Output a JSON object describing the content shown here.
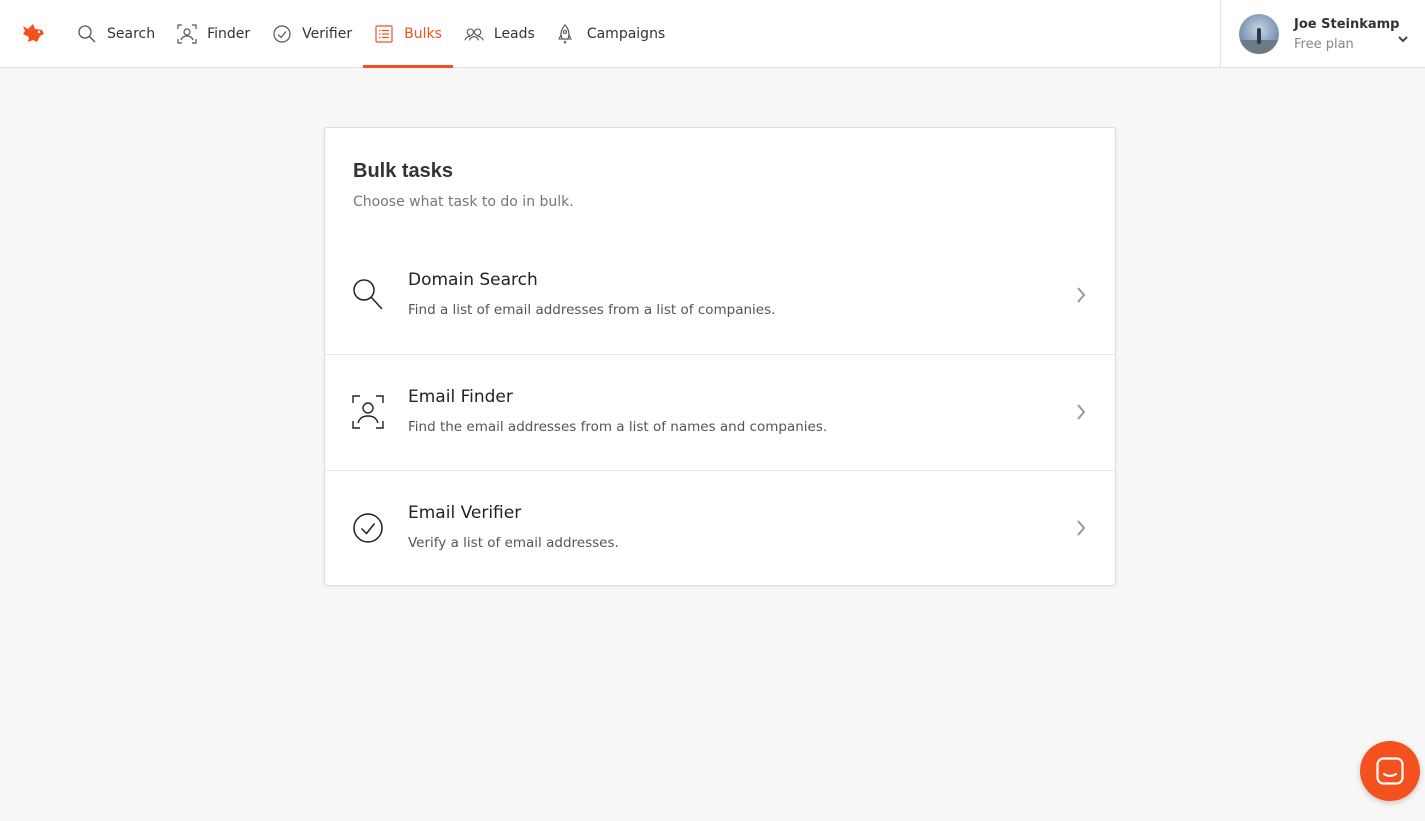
{
  "brand": {
    "logo_icon": "fox-logo-icon",
    "accent": "#f4511e"
  },
  "nav": {
    "items": [
      {
        "label": "Search",
        "icon": "search-icon",
        "active": false
      },
      {
        "label": "Finder",
        "icon": "person-frame-icon",
        "active": false
      },
      {
        "label": "Verifier",
        "icon": "check-circle-icon",
        "active": false
      },
      {
        "label": "Bulks",
        "icon": "list-icon",
        "active": true
      },
      {
        "label": "Leads",
        "icon": "people-icon",
        "active": false
      },
      {
        "label": "Campaigns",
        "icon": "rocket-icon",
        "active": false
      }
    ]
  },
  "account": {
    "name": "Joe Steinkamp",
    "plan": "Free plan"
  },
  "bulk": {
    "title": "Bulk tasks",
    "subtitle": "Choose what task to do in bulk.",
    "tasks": [
      {
        "name": "Domain Search",
        "description": "Find a list of email addresses from a list of companies.",
        "icon": "search-icon"
      },
      {
        "name": "Email Finder",
        "description": "Find the email addresses from a list of names and companies.",
        "icon": "person-frame-icon"
      },
      {
        "name": "Email Verifier",
        "description": "Verify a list of email addresses.",
        "icon": "check-circle-icon"
      }
    ]
  },
  "chat": {
    "icon": "chat-icon"
  }
}
